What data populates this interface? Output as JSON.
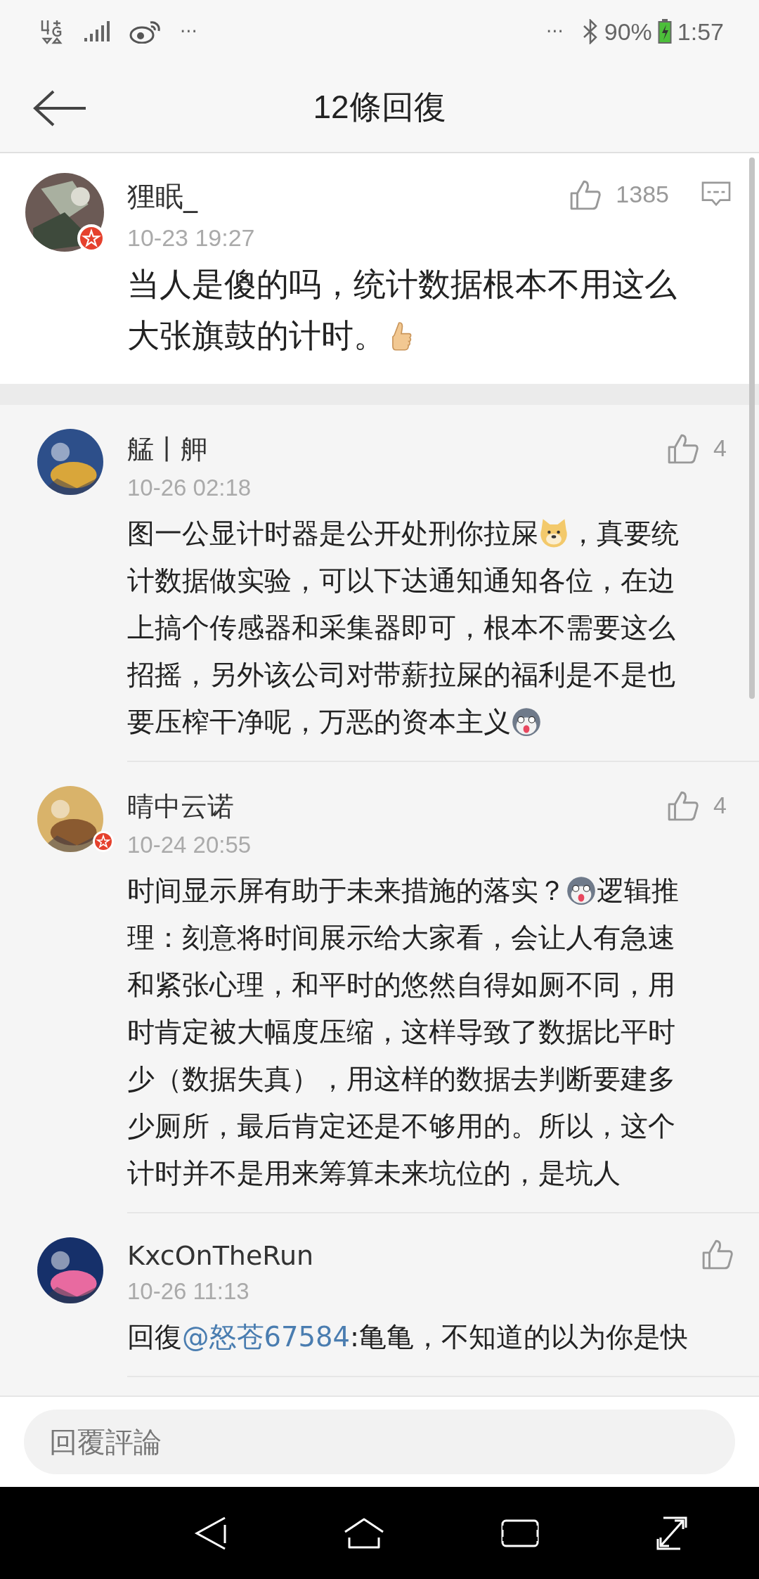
{
  "status_bar": {
    "left_dots": "···",
    "right_dots": "···",
    "battery": "90%",
    "time": "1:57"
  },
  "header": {
    "title": "12條回復"
  },
  "post": {
    "author": "狸眠_",
    "verified": true,
    "time": "10-23 19:27",
    "likes": "1385",
    "segments": [
      {
        "kind": "text",
        "text": "当人是傻的吗，统计数据根本不用这么大张旗鼓的计时。"
      },
      {
        "kind": "thumb"
      }
    ]
  },
  "replies": [
    {
      "author": "艋丨舺",
      "verified": false,
      "time": "10-26 02:18",
      "likes": "4",
      "segments": [
        {
          "kind": "text",
          "text": "图一公显计时器是公开处刑你拉屎"
        },
        {
          "kind": "dog"
        },
        {
          "kind": "text",
          "text": "，真要统计数据做实验，可以下达通知通知各位，在边上搞个传感器和采集器即可，根本不需要这么招摇，另外该公司对带薪拉屎的福利是不是也要压榨干净呢，万恶的资本主义"
        },
        {
          "kind": "husky"
        }
      ]
    },
    {
      "author": "晴中云诺",
      "verified": true,
      "time": "10-24 20:55",
      "likes": "4",
      "segments": [
        {
          "kind": "text",
          "text": "时间显示屏有助于未来措施的落实？"
        },
        {
          "kind": "husky"
        },
        {
          "kind": "text",
          "text": "逻辑推理：刻意将时间展示给大家看，会让人有急速和紧张心理，和平时的悠然自得如厕不同，用时肯定被大幅度压缩，这样导致了数据比平时少（数据失真），用这样的数据去判断要建多少厕所，最后肯定还是不够用的。所以，这个计时并不是用来筹算未来坑位的，是坑人"
        }
      ]
    },
    {
      "author": "KxcOnTheRun",
      "verified": false,
      "time": "10-26 11:13",
      "segments": [
        {
          "kind": "text",
          "text": "回復"
        },
        {
          "kind": "mention",
          "text": "@怒苍67584"
        },
        {
          "kind": "text",
          "text": ":亀亀，不知道的以为你是快"
        }
      ]
    }
  ],
  "reply_field": {
    "placeholder": "回覆評論"
  }
}
